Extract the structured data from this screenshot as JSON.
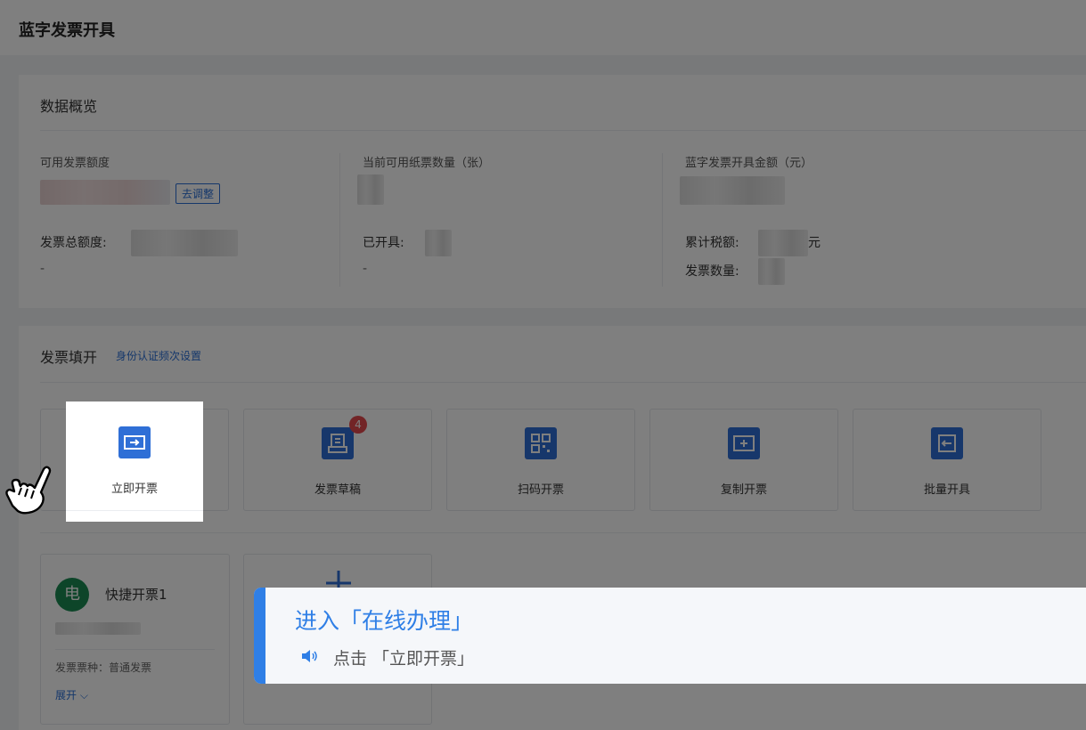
{
  "page": {
    "title": "蓝字发票开具"
  },
  "overview": {
    "title": "数据概览",
    "col1": {
      "label": "可用发票额度",
      "adjust_button": "去调整",
      "total_label": "发票总额度:",
      "total_value": "-"
    },
    "col2": {
      "label": "当前可用纸票数量（张）",
      "issued_label": "已开具:",
      "issued_value": "-"
    },
    "col3": {
      "label": "蓝字发票开具金额（元）",
      "tax_label": "累计税额:",
      "tax_unit": "元",
      "count_label": "发票数量:"
    }
  },
  "fill": {
    "title": "发票填开",
    "identity_link": "身份认证频次设置",
    "actions": [
      {
        "label": "立即开票",
        "icon": "invoice-now-icon"
      },
      {
        "label": "发票草稿",
        "icon": "draft-icon",
        "badge": "4"
      },
      {
        "label": "扫码开票",
        "icon": "qr-code-icon"
      },
      {
        "label": "复制开票",
        "icon": "copy-invoice-icon"
      },
      {
        "label": "批量开具",
        "icon": "batch-issue-icon"
      }
    ],
    "quick": {
      "avatar": "电",
      "name": "快捷开票1",
      "kind": "发票票种：普通发票",
      "expand": "展开 ⌵"
    }
  },
  "tip": {
    "heading": "进入「在线办理」",
    "step": "点击 「立即开票」"
  },
  "colors": {
    "accent": "#2f7fe6",
    "primary": "#2f6fd6",
    "badge": "#e5484d",
    "avatar": "#1a8a52"
  }
}
